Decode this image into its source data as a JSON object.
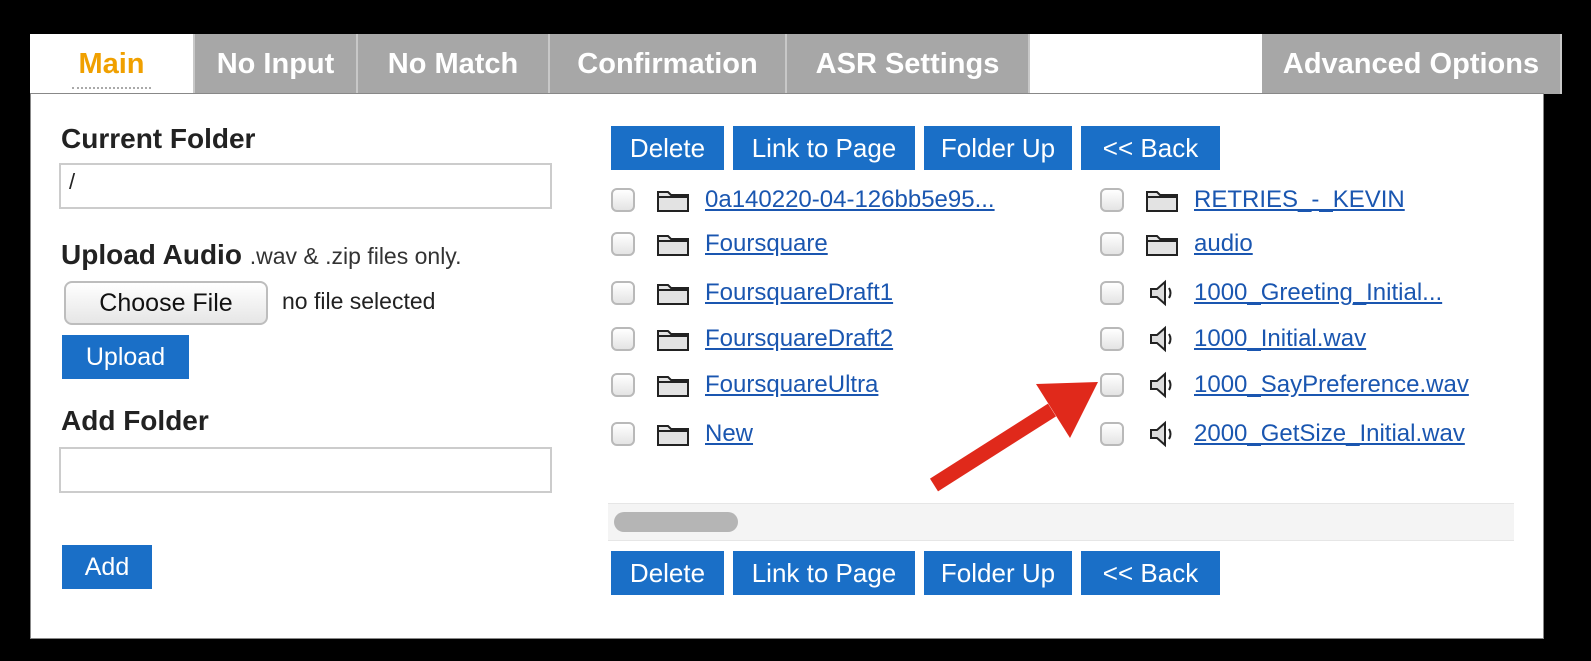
{
  "tabs": [
    {
      "label": "Main",
      "active": true
    },
    {
      "label": "No Input",
      "active": false
    },
    {
      "label": "No Match",
      "active": false
    },
    {
      "label": "Confirmation",
      "active": false
    },
    {
      "label": "ASR Settings",
      "active": false
    },
    {
      "label": "Advanced Options",
      "active": false
    }
  ],
  "left": {
    "current_folder_label": "Current Folder",
    "current_folder_value": "/",
    "upload_label": "Upload Audio",
    "upload_hint": ".wav & .zip files only.",
    "choose_file_label": "Choose File",
    "no_file_text": "no file selected",
    "upload_button": "Upload",
    "add_folder_label": "Add Folder",
    "add_folder_value": "",
    "add_button": "Add"
  },
  "toolbar": {
    "delete": "Delete",
    "link_to_page": "Link to Page",
    "folder_up": "Folder Up",
    "back": "<< Back"
  },
  "files_left": [
    {
      "name": "0a140220-04-126bb5e95...",
      "type": "folder-icon"
    },
    {
      "name": "Foursquare",
      "type": "folder-icon"
    },
    {
      "name": "FoursquareDraft1",
      "type": "folder-icon"
    },
    {
      "name": "FoursquareDraft2",
      "type": "folder-icon"
    },
    {
      "name": "FoursquareUltra",
      "type": "folder-icon"
    },
    {
      "name": "New",
      "type": "folder-icon"
    }
  ],
  "files_right": [
    {
      "name": "RETRIES_-_KEVIN",
      "type": "folder-icon"
    },
    {
      "name": "audio",
      "type": "folder-icon"
    },
    {
      "name": "1000_Greeting_Initial...",
      "type": "speaker-icon"
    },
    {
      "name": "1000_Initial.wav",
      "type": "speaker-icon"
    },
    {
      "name": "1000_SayPreference.wav",
      "type": "speaker-icon"
    },
    {
      "name": "2000_GetSize_Initial.wav",
      "type": "speaker-icon"
    }
  ],
  "colors": {
    "button_blue": "#1a6fc7",
    "tab_inactive": "#a7a7a7",
    "tab_active_text": "#f0a000",
    "link": "#1a56b0",
    "arrow_red": "#e0291b"
  }
}
